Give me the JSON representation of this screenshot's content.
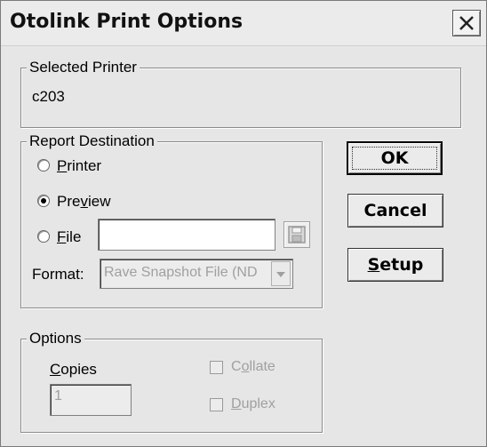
{
  "window": {
    "title": "Otolink Print Options"
  },
  "selected_printer": {
    "legend": "Selected Printer",
    "value": "c203"
  },
  "report_destination": {
    "legend": "Report Destination",
    "printer": {
      "pre": "",
      "key": "P",
      "post": "rinter",
      "selected": false
    },
    "preview": {
      "pre": "Pre",
      "key": "v",
      "post": "iew",
      "selected": true
    },
    "file": {
      "pre": "",
      "key": "F",
      "post": "ile",
      "selected": false,
      "value": ""
    },
    "format_label": "Format:",
    "format_value": "Rave Snapshot File (ND"
  },
  "buttons": {
    "ok": "OK",
    "cancel": "Cancel",
    "setup_key": "S",
    "setup_rest": "etup"
  },
  "options": {
    "legend": "Options",
    "copies_key": "C",
    "copies_rest": "opies",
    "copies_value": "1",
    "collate_pre": "C",
    "collate_key": "o",
    "collate_post": "llate",
    "duplex_key": "D",
    "duplex_rest": "uplex"
  },
  "icons": {
    "close": "close-icon",
    "save": "floppy-disk-icon",
    "dropdown": "chevron-down-icon"
  }
}
